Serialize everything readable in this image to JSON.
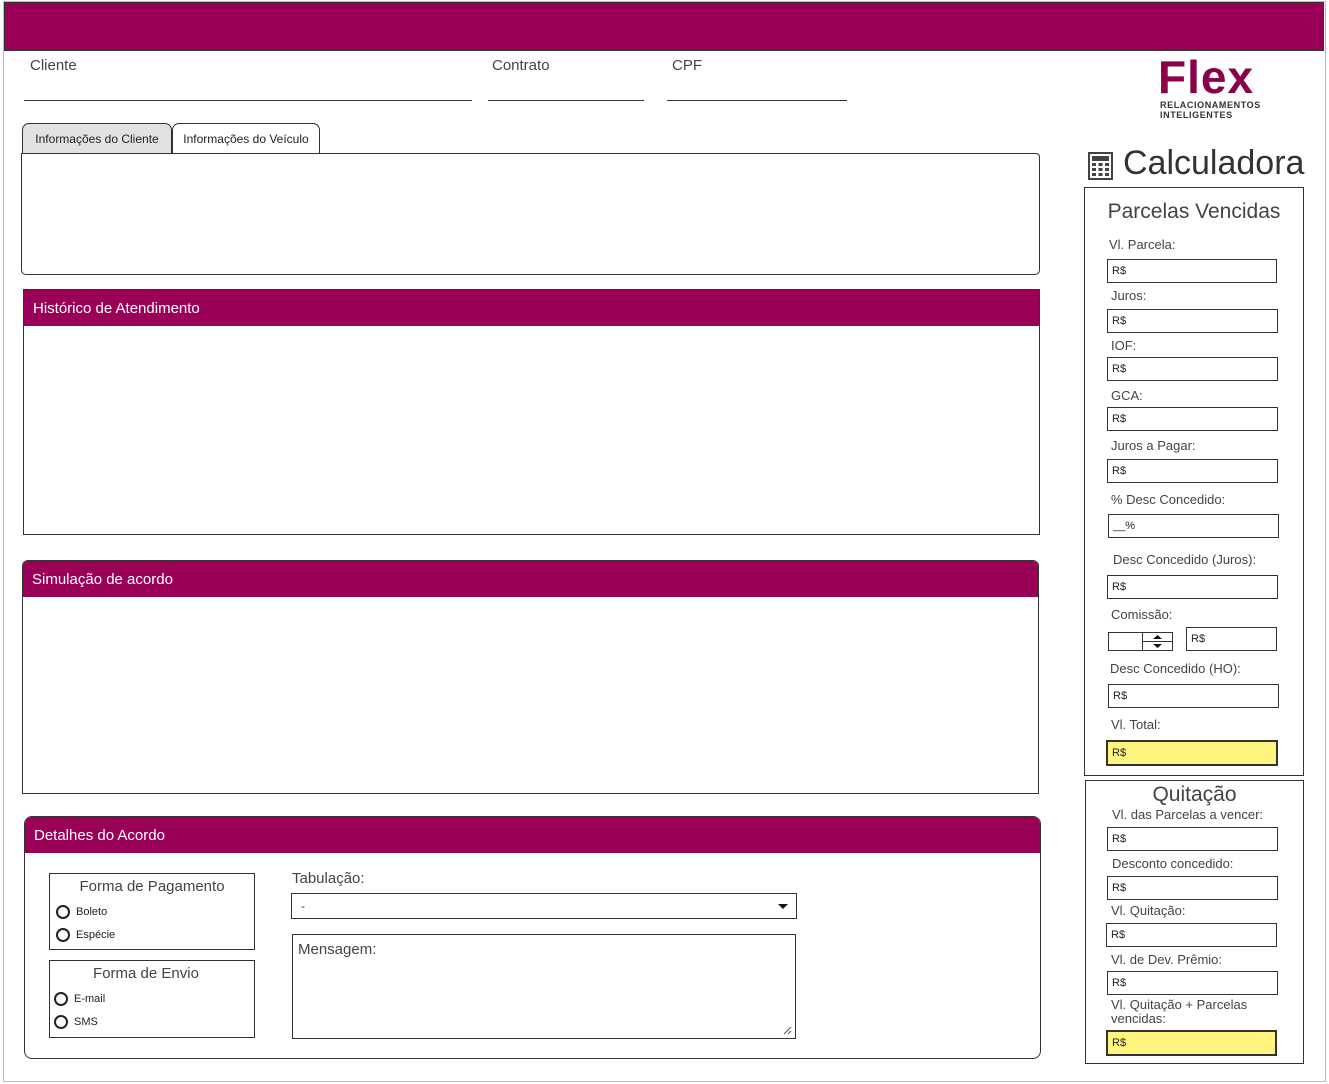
{
  "header": {
    "fields": [
      {
        "label": "Cliente"
      },
      {
        "label": "Contrato"
      },
      {
        "label": "CPF"
      }
    ]
  },
  "logo": {
    "word": "Flex",
    "tagline": "RELACIONAMENTOS INTELIGENTES"
  },
  "tabs": [
    {
      "label": "Informações do Cliente",
      "active": true
    },
    {
      "label": "Informações do Veículo",
      "active": false
    }
  ],
  "sections": {
    "historico": "Histórico de Atendimento",
    "simulacao": "Simulação de acordo",
    "detalhes": "Detalhes do Acordo"
  },
  "acordo": {
    "forma_pagamento": {
      "title": "Forma de Pagamento",
      "options": [
        "Boleto",
        "Espécie"
      ]
    },
    "forma_envio": {
      "title": "Forma de Envio",
      "options": [
        "E-mail",
        "SMS"
      ]
    },
    "tabulacao_label": "Tabulação:",
    "tabulacao_value": "-",
    "mensagem_placeholder": "Mensagem:"
  },
  "calculadora": {
    "title": "Calculadora",
    "parcelas": {
      "title": "Parcelas Vencidas",
      "fields": [
        {
          "label": "Vl. Parcela:",
          "value": "R$"
        },
        {
          "label": "Juros:",
          "value": "R$"
        },
        {
          "label": "IOF:",
          "value": "R$"
        },
        {
          "label": "GCA:",
          "value": "R$"
        },
        {
          "label": "Juros a Pagar:",
          "value": "R$"
        },
        {
          "label": "% Desc Concedido:",
          "value": "__%"
        },
        {
          "label": "Desc Concedido (Juros):",
          "value": "R$"
        },
        {
          "label": "Comissão:",
          "value": "R$"
        },
        {
          "label": "Desc Concedido (HO):",
          "value": "R$"
        },
        {
          "label": "Vl. Total:",
          "value": "R$"
        }
      ]
    },
    "quitacao": {
      "title": "Quitação",
      "fields": [
        {
          "label": "Vl. das Parcelas a vencer:",
          "value": "R$"
        },
        {
          "label": "Desconto concedido:",
          "value": "R$"
        },
        {
          "label": "Vl. Quitação:",
          "value": "R$"
        },
        {
          "label": "Vl. de Dev. Prêmio:",
          "value": "R$"
        },
        {
          "label": "Vl. Quitação + Parcelas vencidas:",
          "value": "R$"
        }
      ]
    }
  },
  "colors": {
    "brand": "#9b0058",
    "highlight": "#fff57e"
  }
}
